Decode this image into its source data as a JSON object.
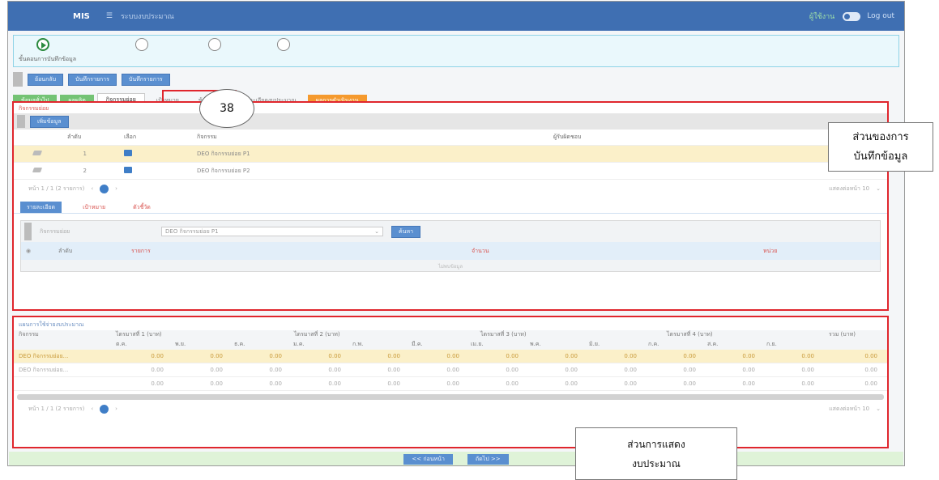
{
  "topbar": {
    "brand": "MIS",
    "menu_icon": "menu-icon",
    "title": "ระบบงบประมาณ",
    "user": "ผู้ใช้งาน",
    "logout": "Log out"
  },
  "steps": {
    "labels": "ขั้นตอนการบันทึกข้อมูล"
  },
  "actions": {
    "back": "ย้อนกลับ",
    "btn1": "บันทึกรายการ",
    "btn2": "บันทึกรายการ"
  },
  "tabs": [
    {
      "label": "ข้อมูลทั่วไป",
      "style": "green"
    },
    {
      "label": "ผลผลิต",
      "style": "green"
    },
    {
      "label": "กิจกรรมย่อย",
      "style": "selected"
    },
    {
      "label": "เป้าหมาย",
      "style": "plain"
    },
    {
      "label": "ข้อมูลอื่น",
      "style": "plain"
    },
    {
      "label": "รายละเอียดงบประมาณ",
      "style": "plain"
    },
    {
      "label": "ผลการดำเนินงาน",
      "style": "orange"
    }
  ],
  "step_bubble": "38",
  "section1": {
    "title": "กิจกรรมย่อย",
    "add_button": "เพิ่มข้อมูล",
    "columns": [
      "ลำดับ",
      "เลือก",
      "กิจกรรม",
      "ผู้รับผิดชอบ"
    ],
    "rows": [
      {
        "no": "1",
        "name": "DEO กิจกรรมย่อย P1"
      },
      {
        "no": "2",
        "name": "DEO กิจกรรมย่อย P2"
      }
    ],
    "pager": "หน้า 1 / 1 (2 รายการ)",
    "page": "1",
    "page_size": "แสดงต่อหน้า 10",
    "subtabs": [
      "รายละเอียด",
      "เป้าหมาย",
      "ตัวชี้วัด"
    ],
    "filter_label": "กิจกรรมย่อย",
    "filter_value": "DEO กิจกรรมย่อย P1",
    "search_button": "ค้นหา",
    "inner_columns": [
      "ลำดับ",
      "รายการ",
      "จำนวน",
      "หน่วย"
    ],
    "empty_text": "ไม่พบข้อมูล"
  },
  "section2": {
    "title": "แผนการใช้จ่ายงบประมาณ",
    "col_activity": "กิจกรรม",
    "quarters": [
      "ไตรมาสที่ 1 (บาท)",
      "ไตรมาสที่ 2 (บาท)",
      "ไตรมาสที่ 3 (บาท)",
      "ไตรมาสที่ 4 (บาท)"
    ],
    "months": [
      "ต.ค.",
      "พ.ย.",
      "ธ.ค.",
      "ม.ค.",
      "ก.พ.",
      "มี.ค.",
      "เม.ย.",
      "พ.ค.",
      "มิ.ย.",
      "ก.ค.",
      "ส.ค.",
      "ก.ย."
    ],
    "col_total": "รวม (บาท)",
    "rows": [
      {
        "name": "DEO กิจกรรมย่อย...",
        "values": [
          "0.00",
          "0.00",
          "0.00",
          "0.00",
          "0.00",
          "0.00",
          "0.00",
          "0.00",
          "0.00",
          "0.00",
          "0.00",
          "0.00",
          "0.00"
        ]
      },
      {
        "name": "DEO กิจกรรมย่อย...",
        "values": [
          "0.00",
          "0.00",
          "0.00",
          "0.00",
          "0.00",
          "0.00",
          "0.00",
          "0.00",
          "0.00",
          "0.00",
          "0.00",
          "0.00",
          "0.00"
        ]
      },
      {
        "name": "",
        "values": [
          "0.00",
          "0.00",
          "0.00",
          "0.00",
          "0.00",
          "0.00",
          "0.00",
          "0.00",
          "0.00",
          "0.00",
          "0.00",
          "0.00",
          "0.00"
        ]
      }
    ],
    "pager": "หน้า 1 / 1 (2 รายการ)",
    "page": "1",
    "page_size": "แสดงต่อหน้า 10"
  },
  "bottom": {
    "prev": "<< ก่อนหน้า",
    "next": "ถัดไป >>"
  },
  "callout1": {
    "line1": "ส่วนของการ",
    "line2": "บันทึกข้อมูล"
  },
  "callout2": {
    "line1": "ส่วนการแสดง",
    "line2": "งบประมาณ"
  }
}
